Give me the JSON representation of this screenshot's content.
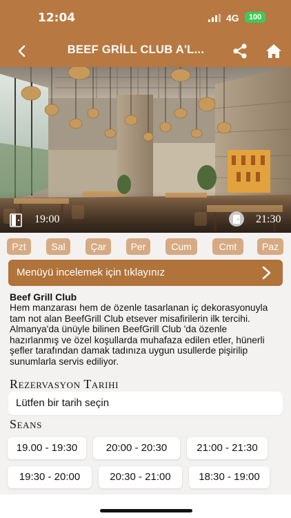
{
  "status_bar": {
    "time": "12:04",
    "network": "4G",
    "battery": "100"
  },
  "header": {
    "title": "BEEF GRİLL CLUB A'L..."
  },
  "hero": {
    "open_time": "19:00",
    "close_time": "21:30"
  },
  "days": [
    "Pzt",
    "Sal",
    "Çar",
    "Per",
    "Cum",
    "Cmt",
    "Paz"
  ],
  "menu_button": {
    "label": "Menüyü incelemek için tıklayınız"
  },
  "description": {
    "title": "Beef Grill Club",
    "text": "Hem manzarası hem de özenle tasarlanan iç dekorasyonuyla tam not alan BeefGrill Club etsever misafirilerin ilk tercihi. Almanya'da ünüyle bilinen BeefGrill Club 'da özenle hazırlanmış ve özel koşullarda muhafaza edilen etler, hünerli şefler tarafından damak tadınıza uygun usullerde pişirilip sunumlarla servis ediliyor."
  },
  "reservation": {
    "heading": "Rezervasyon Tarihi",
    "date_placeholder": "Lütfen bir tarih seçin"
  },
  "sessions": {
    "heading": "Seans",
    "slots": [
      "19.00 - 19:30",
      "20:00 - 20:30",
      "21:00 - 21:30",
      "19:30 - 20:00",
      "20:30 - 21:00",
      "18:30 - 19:00"
    ]
  },
  "colors": {
    "brand": "#b87841",
    "button": "#b0733a",
    "day_tab": "#d6aa83",
    "background": "#f3f2f1"
  }
}
